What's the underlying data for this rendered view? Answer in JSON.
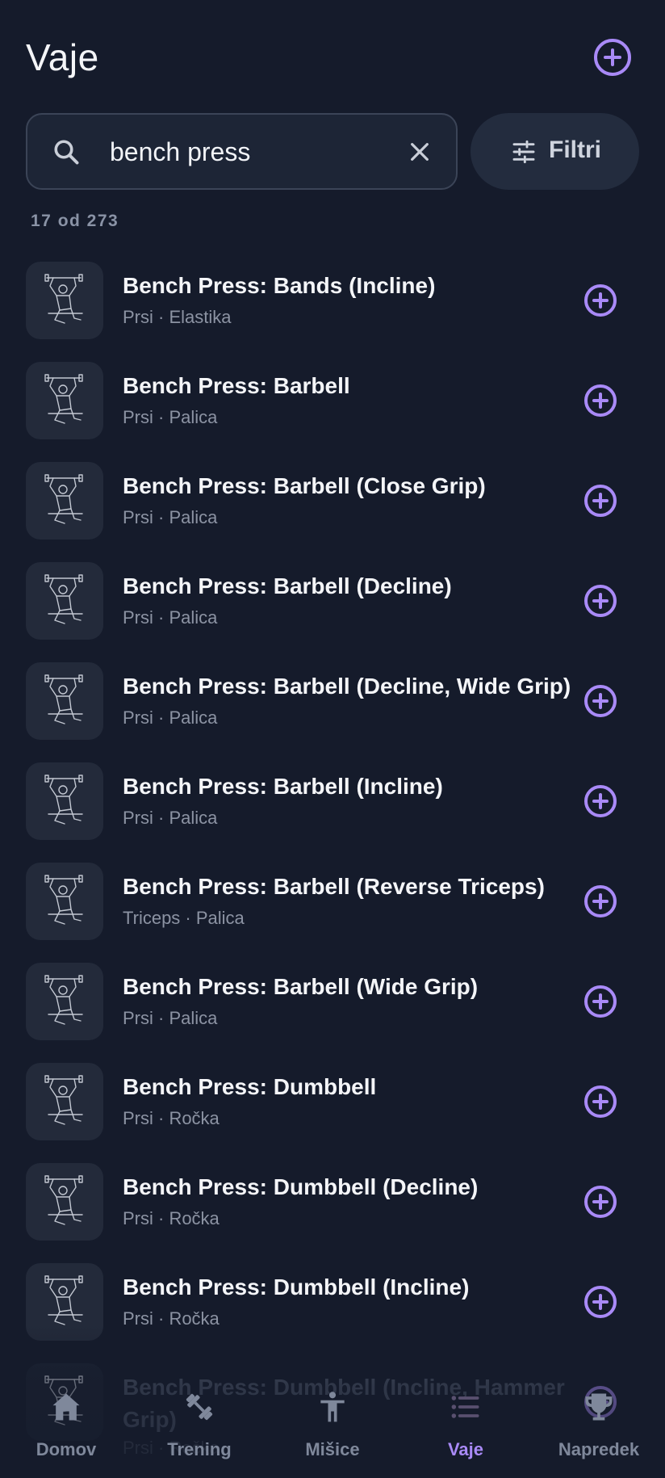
{
  "header": {
    "title": "Vaje"
  },
  "search": {
    "value": "bench press"
  },
  "filter": {
    "label": "Filtri"
  },
  "result_count": "17 od 273",
  "exercises": [
    {
      "name": "Bench Press: Bands (Incline)",
      "meta": "Prsi · Elastika"
    },
    {
      "name": "Bench Press: Barbell",
      "meta": "Prsi · Palica"
    },
    {
      "name": "Bench Press: Barbell (Close Grip)",
      "meta": "Prsi · Palica"
    },
    {
      "name": "Bench Press: Barbell (Decline)",
      "meta": "Prsi · Palica"
    },
    {
      "name": "Bench Press: Barbell (Decline, Wide Grip)",
      "meta": "Prsi · Palica"
    },
    {
      "name": "Bench Press: Barbell (Incline)",
      "meta": "Prsi · Palica"
    },
    {
      "name": "Bench Press: Barbell (Reverse Triceps)",
      "meta": "Triceps · Palica"
    },
    {
      "name": "Bench Press: Barbell (Wide Grip)",
      "meta": "Prsi · Palica"
    },
    {
      "name": "Bench Press: Dumbbell",
      "meta": "Prsi · Ročka"
    },
    {
      "name": "Bench Press: Dumbbell (Decline)",
      "meta": "Prsi · Ročka"
    },
    {
      "name": "Bench Press: Dumbbell (Incline)",
      "meta": "Prsi · Ročka"
    },
    {
      "name": "Bench Press: Dumbbell (Incline, Hammer Grip)",
      "meta": "Prsi · Ročka"
    }
  ],
  "nav": [
    {
      "label": "Domov",
      "icon": "home-icon"
    },
    {
      "label": "Trening",
      "icon": "dumbbell-icon"
    },
    {
      "label": "Mišice",
      "icon": "person-icon"
    },
    {
      "label": "Vaje",
      "icon": "list-icon",
      "active": true
    },
    {
      "label": "Napredek",
      "icon": "trophy-icon"
    }
  ],
  "colors": {
    "accent": "#a98af7",
    "background": "#151b2b",
    "surface": "#1d2536"
  }
}
